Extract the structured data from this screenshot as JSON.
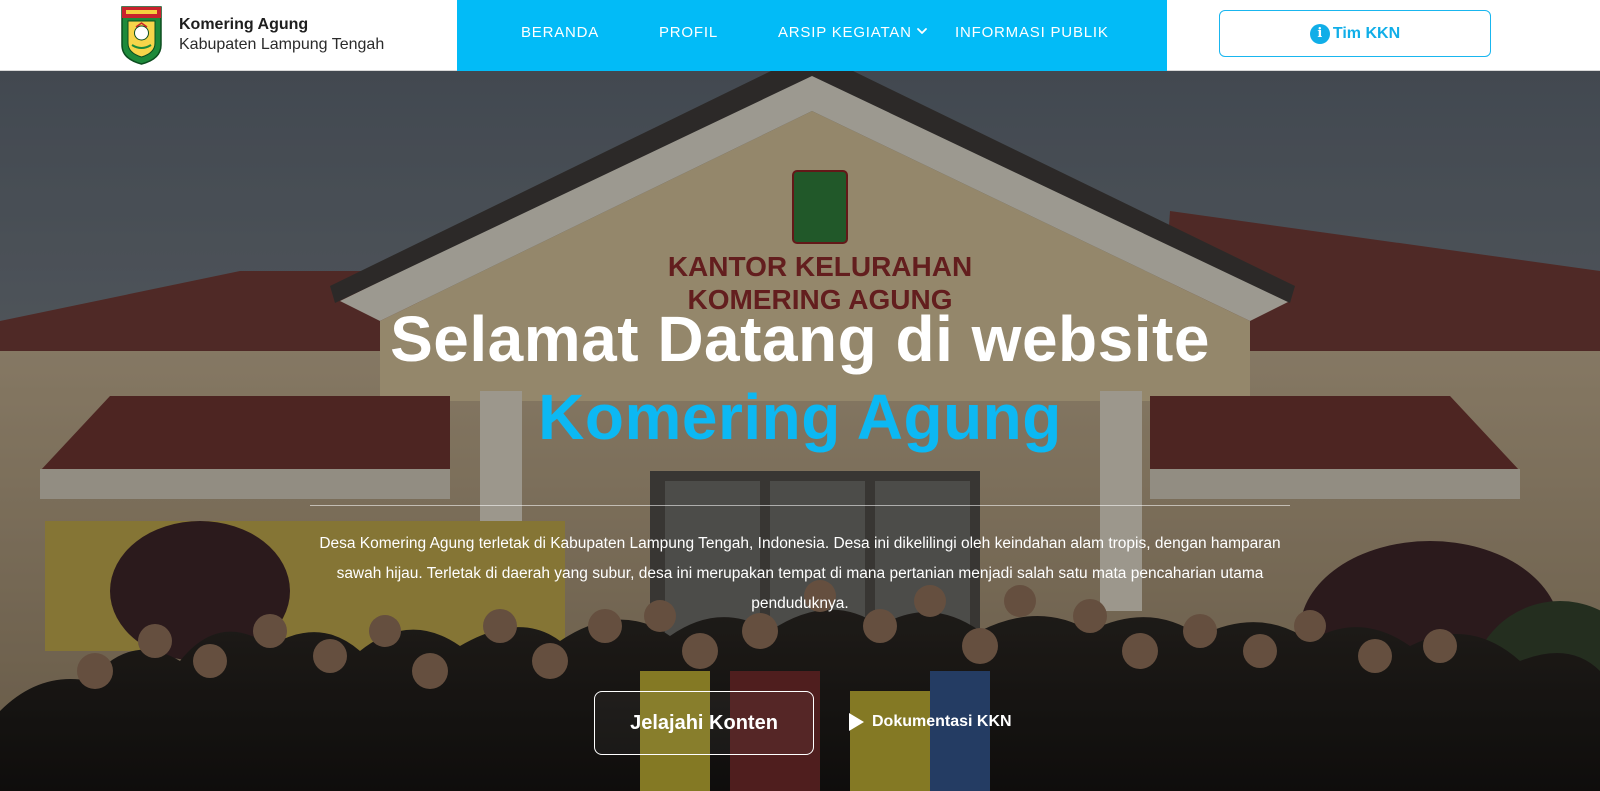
{
  "brand": {
    "title": "Komering Agung",
    "subtitle": "Kabupaten Lampung Tengah",
    "logo_icon": "lampung-tengah-crest-icon"
  },
  "nav": {
    "items": [
      {
        "label": "BERANDA"
      },
      {
        "label": "PROFIL"
      },
      {
        "label": "ARSIP KEGIATAN",
        "has_dropdown": true
      },
      {
        "label": "INFORMASI PUBLIK"
      }
    ],
    "background": "#02bbf7"
  },
  "header_button": {
    "label": "Tim KKN",
    "icon": "info-icon",
    "color": "#10aee8"
  },
  "hero": {
    "title": "Selamat Datang di website",
    "subtitle": "Komering Agung",
    "subtitle_color": "#0cb8f3",
    "description": "Desa Komering Agung terletak di Kabupaten Lampung Tengah, Indonesia. Desa ini dikelilingi oleh keindahan alam tropis, dengan hamparan sawah hijau. Terletak di daerah yang subur, desa ini merupakan tempat di mana pertanian menjadi salah satu mata pencaharian utama penduduknya.",
    "cta_label": "Jelajahi Konten",
    "doc_label": "Dokumentasi KKN",
    "doc_icon": "play-icon",
    "background_sign_line1": "KANTOR KELURAHAN",
    "background_sign_line2": "KOMERING AGUNG"
  }
}
